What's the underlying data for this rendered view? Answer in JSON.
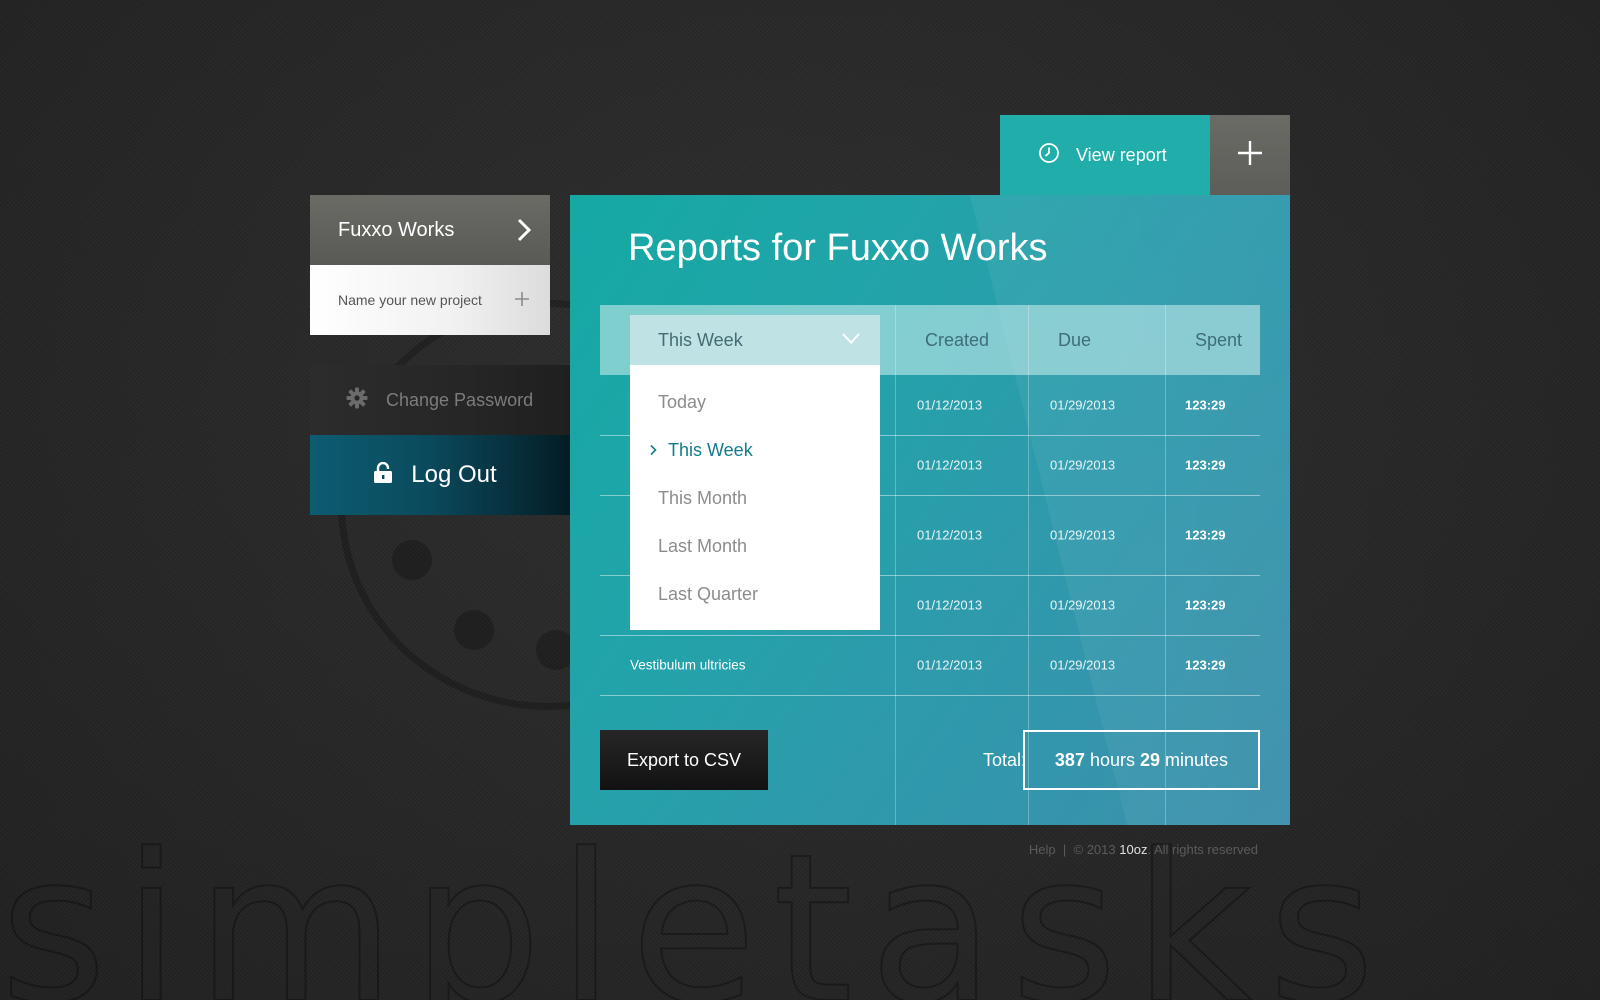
{
  "project": {
    "name": "Fuxxo Works",
    "new_project_placeholder": "Name your new project"
  },
  "account": {
    "change_password": "Change Password",
    "log_out": "Log Out"
  },
  "tabs": {
    "view_report": "View report"
  },
  "report": {
    "title": "Reports for Fuxxo Works",
    "filter": {
      "selected": "This Week",
      "options": [
        "Today",
        "This Week",
        "This Month",
        "Last Month",
        "Last Quarter"
      ]
    },
    "columns": {
      "created": "Created",
      "due": "Due",
      "spent": "Spent"
    },
    "rows": [
      {
        "name": "",
        "created": "01/12/2013",
        "due": "01/29/2013",
        "spent": "123:29"
      },
      {
        "name": "",
        "created": "01/12/2013",
        "due": "01/29/2013",
        "spent": "123:29"
      },
      {
        "name": "",
        "created": "01/12/2013",
        "due": "01/29/2013",
        "spent": "123:29"
      },
      {
        "name": "",
        "created": "01/12/2013",
        "due": "01/29/2013",
        "spent": "123:29"
      },
      {
        "name": "Vestibulum ultricies",
        "created": "01/12/2013",
        "due": "01/29/2013",
        "spent": "123:29"
      }
    ],
    "export_label": "Export to CSV",
    "total": {
      "label": "Total:",
      "hours": "387",
      "hours_unit": "hours",
      "minutes": "29",
      "minutes_unit": "minutes"
    }
  },
  "footer": {
    "help": "Help",
    "separator": "|",
    "copyright": "© 2013",
    "brand": "10oz",
    "rights": ". All rights reserved"
  },
  "background_word": "simpletasks",
  "colors": {
    "accent_teal": "#21aeaa",
    "panel_gradient_end": "#3c8fab",
    "logout_blue": "#0d5c71",
    "active_item": "#137c8c"
  }
}
